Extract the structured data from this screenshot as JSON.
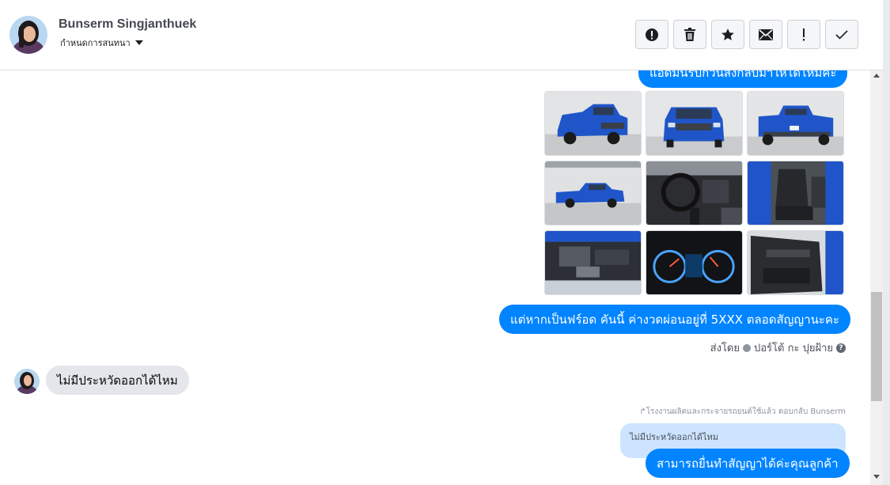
{
  "header": {
    "contact_name": "Bunserm Singjanthuek",
    "label_picker": "กำหนดการสนทนา",
    "actions": [
      {
        "icon": "alert-circle-icon",
        "glyph": "!"
      },
      {
        "icon": "trash-icon",
        "glyph": "trash"
      },
      {
        "icon": "star-icon",
        "glyph": "★"
      },
      {
        "icon": "envelope-icon",
        "glyph": "✉"
      },
      {
        "icon": "exclamation-icon",
        "glyph": "!"
      },
      {
        "icon": "checkmark-icon",
        "glyph": "✓"
      }
    ]
  },
  "messages": {
    "top_clipped": "แอดมินรับกวันส่งกลับมาให้ได้ไหมคะ",
    "installment": "แต่หากเป็นฟร์อด คันนี้ ค่างวดผ่อนอยู่ที่ 5XXX ตลอดสัญญานะคะ",
    "sent_by_prefix": "ส่งโดย",
    "sent_by_name": "ปอร์โต้ กะ ปุยฝ้าย",
    "incoming": "ไม่มีประหวัดออกได้ไหม",
    "reply_meta": "โรงงานผลิตและกระจายรถยนต์ใช้แล้ว ตอบกลับ Bunserm",
    "quoted": "ไม่มีประหวัดออกได้ไหม",
    "reply": "สามารถยื่นทำสัญญาได้ค่ะคุณลูกค้า"
  },
  "photos": [
    {
      "name": "truck-front-left-photo"
    },
    {
      "name": "truck-front-photo"
    },
    {
      "name": "truck-rear-photo"
    },
    {
      "name": "truck-side-photo"
    },
    {
      "name": "truck-dashboard-photo"
    },
    {
      "name": "truck-front-seats-photo"
    },
    {
      "name": "truck-engine-photo"
    },
    {
      "name": "truck-gauge-cluster-photo"
    },
    {
      "name": "truck-door-panel-photo"
    }
  ],
  "colors": {
    "accent": "#0084ff",
    "incoming_bubble": "#e4e6eb",
    "quoted_bubble": "#cce4ff",
    "truck_blue": "#1f55c8"
  }
}
